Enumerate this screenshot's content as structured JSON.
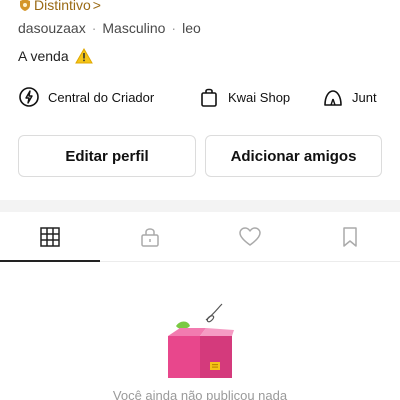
{
  "profile": {
    "badge_label": "Distintivo",
    "badge_chevron": ">",
    "username": "dasouzaax",
    "gender": "Masculino",
    "sign": "leo",
    "separator": "·",
    "bio": "A venda"
  },
  "links": {
    "creator": "Central do Criador",
    "shop": "Kwai Shop",
    "third": "Junt"
  },
  "buttons": {
    "edit": "Editar perfil",
    "add_friends": "Adicionar amigos"
  },
  "tabs": [
    {
      "icon": "grid-icon",
      "active": true
    },
    {
      "icon": "lock-icon",
      "active": false
    },
    {
      "icon": "heart-icon",
      "active": false
    },
    {
      "icon": "bookmark-icon",
      "active": false
    }
  ],
  "empty_state": {
    "message": "Você ainda não publicou nada"
  },
  "colors": {
    "badge": "#d4962a",
    "warning": "#f5c518",
    "box": "#e8478c",
    "leaf": "#7ac943",
    "active_underline": "#222222"
  }
}
